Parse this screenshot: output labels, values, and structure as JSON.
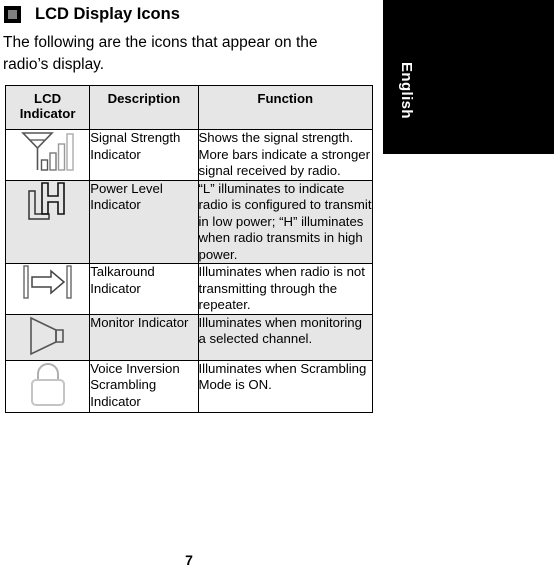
{
  "page": {
    "number": "7",
    "language_tab": "English"
  },
  "section": {
    "bullet_icon": "square-bullet-icon",
    "title": "LCD Display Icons",
    "intro": "The following are the icons that appear on the radio’s display."
  },
  "table": {
    "headers": {
      "icon": "LCD Indicator",
      "description": "Description",
      "function": "Function"
    },
    "rows": [
      {
        "icon_name": "signal-strength-icon",
        "description": "Signal Strength Indicator",
        "function": "Shows the signal strength. More bars indicate a stronger signal received by radio.",
        "shading": "white"
      },
      {
        "icon_name": "power-level-lh-icon",
        "description": "Power Level Indicator",
        "function": "“L” illuminates to indicate radio is configured to transmit in low power; “H” illuminates when radio transmits in high power.",
        "shading": "gray"
      },
      {
        "icon_name": "talkaround-arrow-icon",
        "description": "Talkaround Indicator",
        "function": "Illuminates when radio is not transmitting through the repeater.",
        "shading": "white"
      },
      {
        "icon_name": "monitor-speaker-icon",
        "description": "Monitor Indicator",
        "function": "Illuminates when monitoring a selected channel.",
        "shading": "gray"
      },
      {
        "icon_name": "voice-inversion-lock-icon",
        "description": "Voice Inversion Scrambling Indicator",
        "function": "Illuminates when Scrambling Mode is ON.",
        "shading": "white"
      }
    ]
  },
  "colors": {
    "header_background": "#e6e6e6",
    "row_shaded_background": "#e6e6e6",
    "row_plain_background": "#ffffff",
    "language_tab_background": "#000000",
    "language_tab_text": "#ffffff",
    "border": "#000000"
  }
}
